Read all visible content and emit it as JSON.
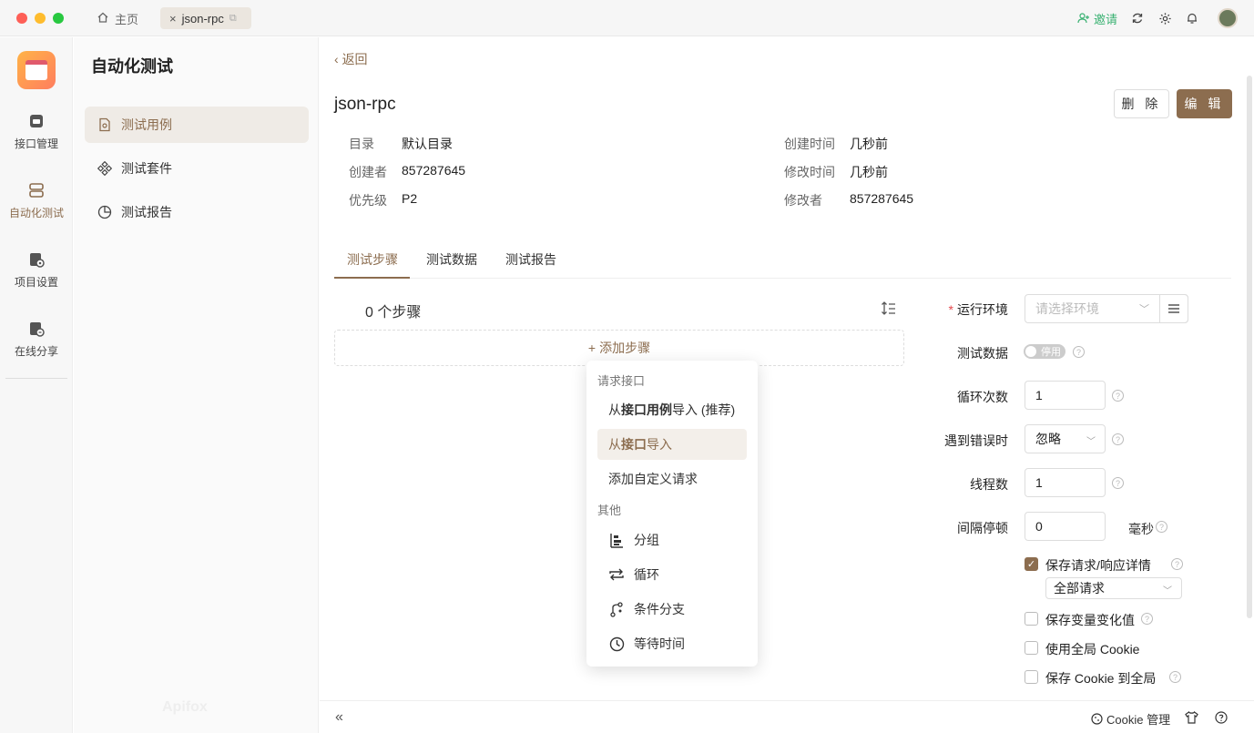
{
  "titlebar": {
    "home_tab": "主页",
    "active_tab": "json-rpc",
    "invite": "邀请"
  },
  "leftnav": {
    "items": [
      {
        "label": "接口管理",
        "icon": "api-icon"
      },
      {
        "label": "自动化测试",
        "icon": "automation-icon"
      },
      {
        "label": "项目设置",
        "icon": "settings-icon"
      },
      {
        "label": "在线分享",
        "icon": "share-icon"
      }
    ],
    "watermark": "Apifox"
  },
  "sidebar": {
    "title": "自动化测试",
    "items": [
      {
        "label": "测试用例",
        "icon": "test-case-icon"
      },
      {
        "label": "测试套件",
        "icon": "test-suite-icon"
      },
      {
        "label": "测试报告",
        "icon": "report-icon"
      }
    ]
  },
  "main": {
    "back": "返回",
    "title": "json-rpc",
    "delete_label": "删 除",
    "edit_label": "编 辑",
    "meta": {
      "dir_label": "目录",
      "dir_value": "默认目录",
      "creator_label": "创建者",
      "creator_value": "857287645",
      "priority_label": "优先级",
      "priority_value": "P2",
      "created_label": "创建时间",
      "created_value": "几秒前",
      "modified_label": "修改时间",
      "modified_value": "几秒前",
      "modifier_label": "修改者",
      "modifier_value": "857287645"
    },
    "tabs": [
      "测试步骤",
      "测试数据",
      "测试报告"
    ],
    "steps_count": "0 个步骤",
    "add_step": "添加步骤"
  },
  "dropdown": {
    "group1": "请求接口",
    "item1_pre": "从",
    "item1_bold": "接口用例",
    "item1_post": "导入 (推荐)",
    "item2_pre": "从",
    "item2_bold": "接口",
    "item2_post": "导入",
    "item3": "添加自定义请求",
    "group2": "其他",
    "item4": "分组",
    "item5": "循环",
    "item6": "条件分支",
    "item7": "等待时间"
  },
  "settings": {
    "env_label": "运行环境",
    "env_placeholder": "请选择环境",
    "data_label": "测试数据",
    "data_toggle": "停用",
    "loop_label": "循环次数",
    "loop_value": "1",
    "error_label": "遇到错误时",
    "error_value": "忽略",
    "threads_label": "线程数",
    "threads_value": "1",
    "interval_label": "间隔停顿",
    "interval_value": "0",
    "interval_unit": "毫秒",
    "save_detail_label": "保存请求/响应详情",
    "save_detail_checked": true,
    "save_detail_scope": "全部请求",
    "save_vars_label": "保存变量变化值",
    "global_cookie_label": "使用全局 Cookie",
    "save_cookie_label": "保存 Cookie 到全局"
  },
  "bottombar": {
    "cookie": "Cookie 管理"
  }
}
